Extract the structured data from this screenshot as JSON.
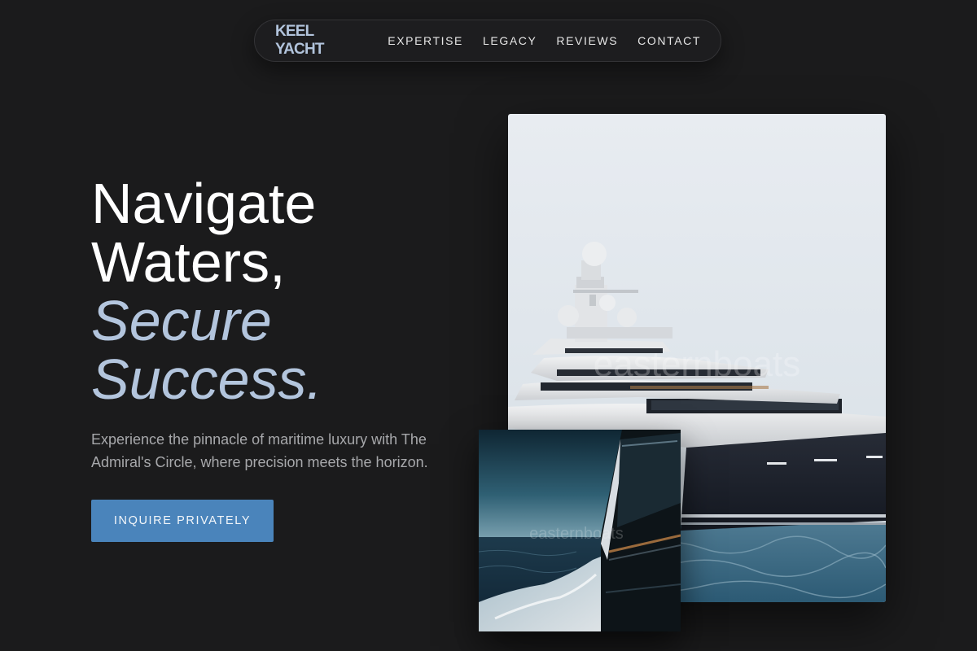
{
  "nav": {
    "brand": "KEEL YACHT",
    "links": [
      "EXPERTISE",
      "LEGACY",
      "REVIEWS",
      "CONTACT"
    ]
  },
  "hero": {
    "title_lines": [
      "Navigate",
      "Waters,"
    ],
    "title_accent_lines": [
      "Secure",
      "Success."
    ],
    "subtitle": "Experience the pinnacle of maritime luxury with The Admiral's Circle, where precision meets the horizon.",
    "cta_label": "INQUIRE PRIVATELY"
  },
  "images": {
    "main_alt": "Superyacht bow on open sea",
    "small_alt": "Side of yacht with wake",
    "watermark": "easternboats"
  },
  "colors": {
    "background": "#1b1b1c",
    "accent_text": "#b3c5dd",
    "button": "#4a84bb"
  }
}
